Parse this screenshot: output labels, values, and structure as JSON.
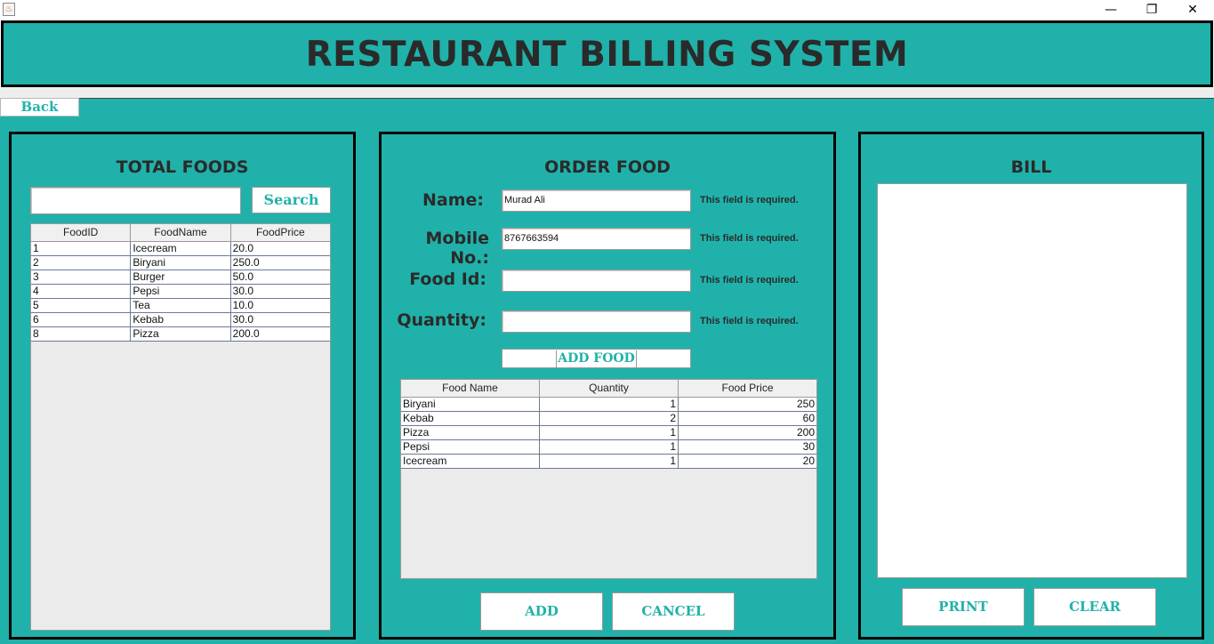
{
  "window": {
    "icon": "java-app-icon",
    "controls": {
      "minimize": "—",
      "maximize": "❐",
      "close": "✕"
    }
  },
  "header": {
    "title": "RESTAURANT BILLING SYSTEM"
  },
  "back_label": "Back",
  "total_foods": {
    "title": "TOTAL FOODS",
    "search_value": "",
    "search_label": "Search",
    "columns": [
      "FoodID",
      "FoodName",
      "FoodPrice"
    ],
    "rows": [
      [
        "1",
        "Icecream",
        "20.0"
      ],
      [
        "2",
        "Biryani",
        "250.0"
      ],
      [
        "3",
        "Burger",
        "50.0"
      ],
      [
        "4",
        "Pepsi",
        "30.0"
      ],
      [
        "5",
        "Tea",
        "10.0"
      ],
      [
        "6",
        "Kebab",
        "30.0"
      ],
      [
        "8",
        "Pizza",
        "200.0"
      ]
    ]
  },
  "order_food": {
    "title": "ORDER FOOD",
    "fields": [
      {
        "label": "Name:",
        "value": "Murad Ali",
        "required": "This field is required."
      },
      {
        "label": "Mobile No.:",
        "value": "8767663594",
        "required": "This field is required."
      },
      {
        "label": "Food Id:",
        "value": "",
        "required": "This field is required."
      },
      {
        "label": "Quantity:",
        "value": "",
        "required": "This field is required."
      }
    ],
    "add_food_label": "ADD FOOD",
    "columns": [
      "Food Name",
      "Quantity",
      "Food Price"
    ],
    "rows": [
      [
        "Biryani",
        "1",
        "250"
      ],
      [
        "Kebab",
        "2",
        "60"
      ],
      [
        "Pizza",
        "1",
        "200"
      ],
      [
        "Pepsi",
        "1",
        "30"
      ],
      [
        "Icecream",
        "1",
        "20"
      ]
    ],
    "add_label": "ADD",
    "cancel_label": "CANCEL"
  },
  "bill": {
    "title": "BILL",
    "content": "",
    "print_label": "PRINT",
    "clear_label": "CLEAR"
  },
  "colors": {
    "accent": "#20b2aa",
    "text_dark": "#2a2a2a",
    "border": "#000000"
  }
}
